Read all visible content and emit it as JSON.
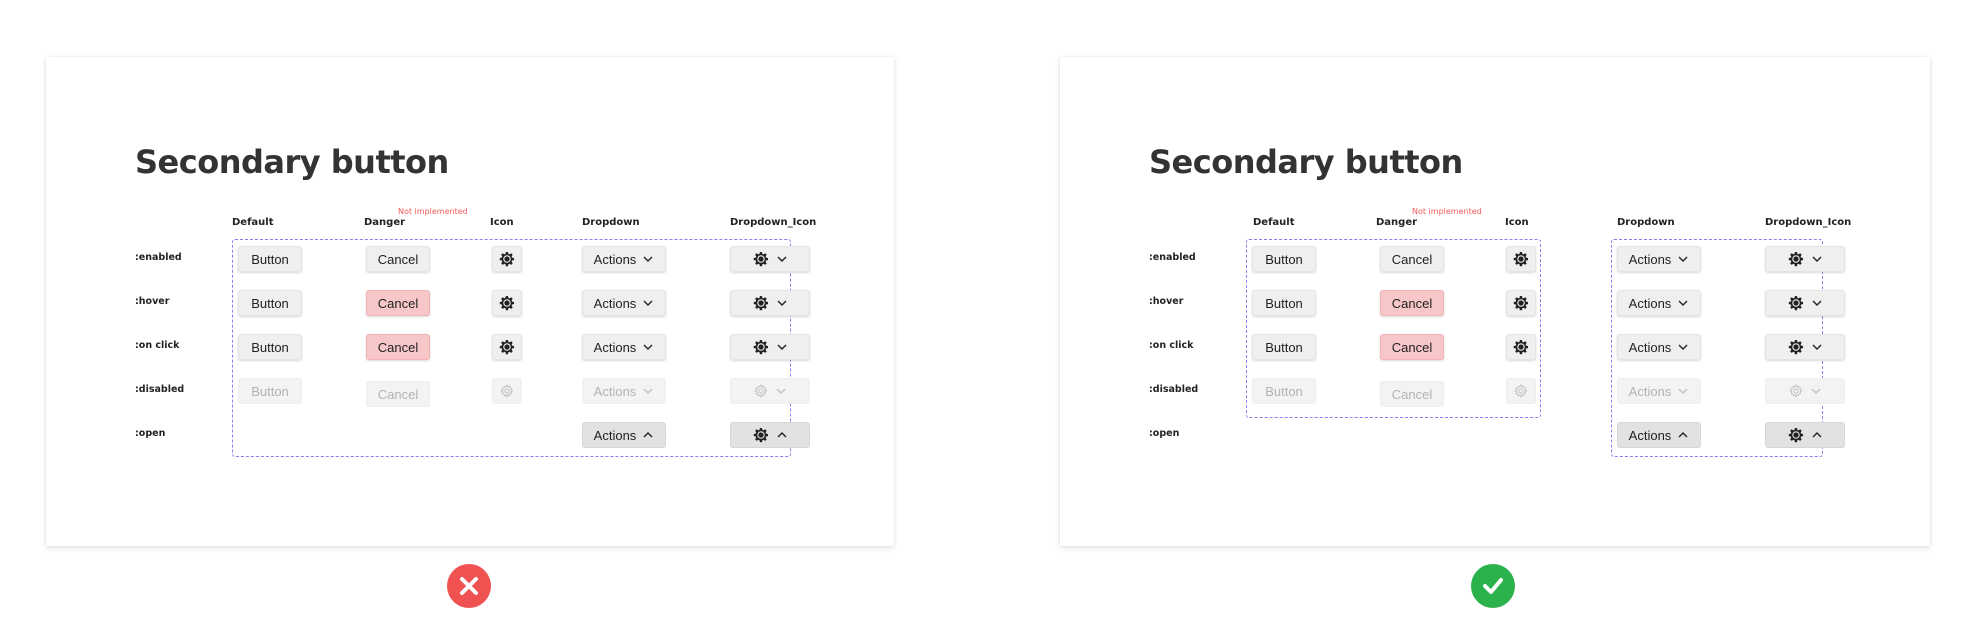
{
  "panels": [
    {
      "title": "Secondary button",
      "note": "Not implemented",
      "columns": [
        "Default",
        "Danger",
        "Icon",
        "Dropdown",
        "Dropdown_Icon"
      ],
      "rows": [
        ":enabled",
        ":hover",
        ":on click",
        ":disabled",
        ":open"
      ],
      "button_label": "Button",
      "danger_label": "Cancel",
      "dropdown_label": "Actions"
    },
    {
      "title": "Secondary button",
      "note": "Not implemented",
      "columns": [
        "Default",
        "Danger",
        "Icon",
        "Dropdown",
        "Dropdown_Icon"
      ],
      "rows": [
        ":enabled",
        ":hover",
        ":on click",
        ":disabled",
        ":open"
      ],
      "button_label": "Button",
      "danger_label": "Cancel",
      "dropdown_label": "Actions"
    }
  ],
  "colors": {
    "dashed_border": "#8f7cf2",
    "danger_hover_bg": "#f7c6c8",
    "note_text": "#f25c5c",
    "wrong_badge": "#f05252",
    "right_badge": "#2bb24c"
  },
  "icons": {
    "settings": "gear-icon",
    "dropdown_closed": "chevron-down-icon",
    "dropdown_open": "chevron-up-icon",
    "wrong": "close-icon",
    "right": "check-icon"
  }
}
